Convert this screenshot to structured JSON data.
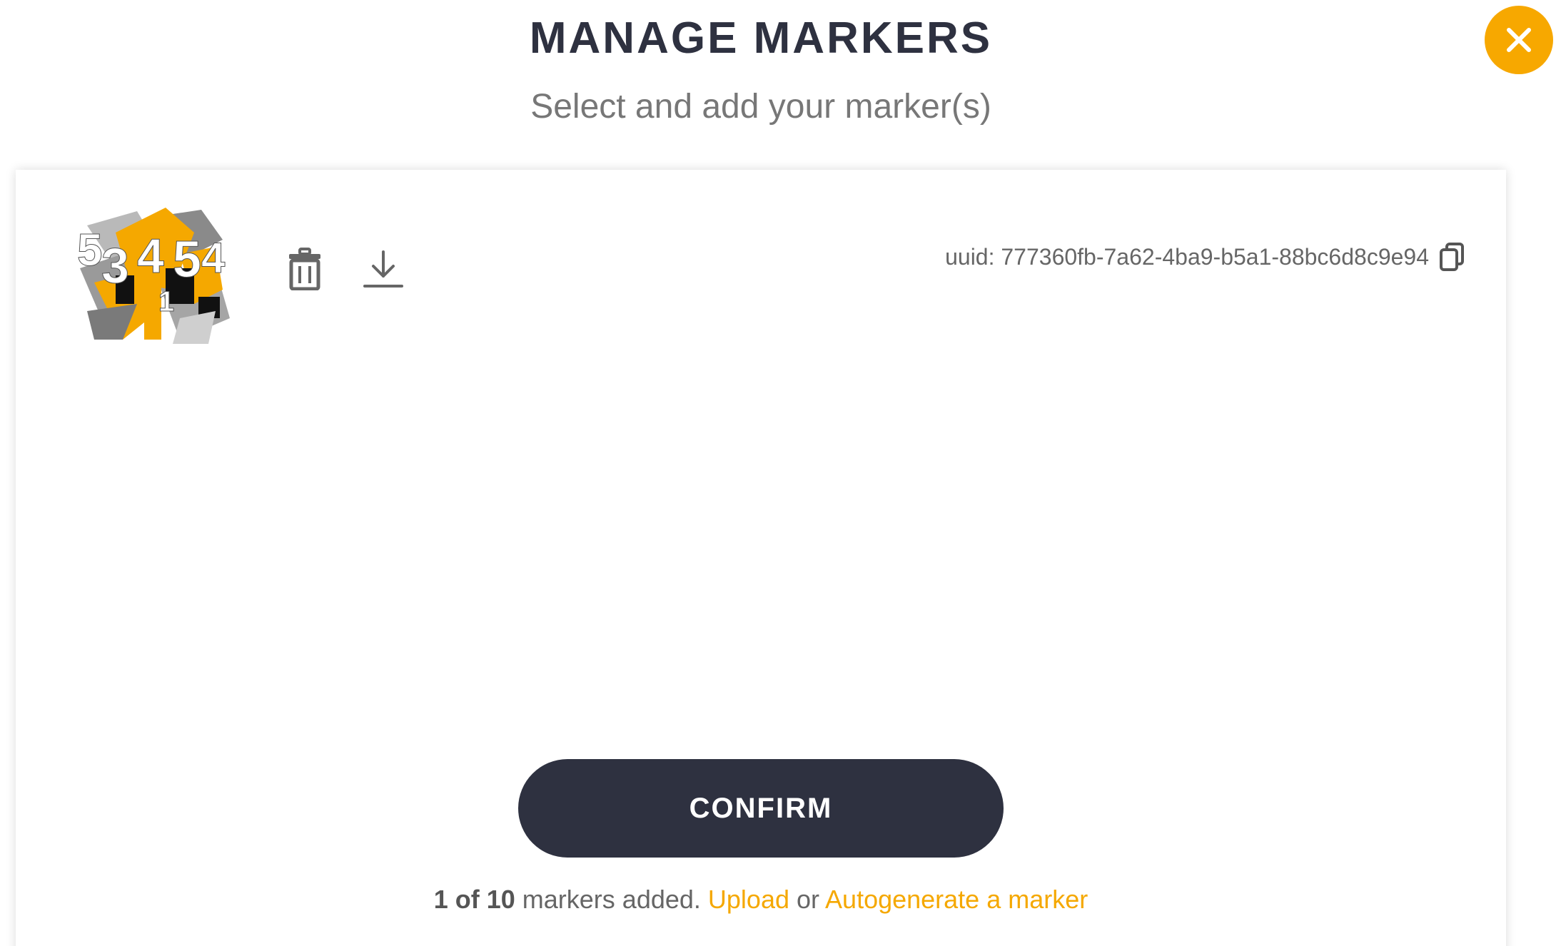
{
  "header": {
    "title": "MANAGE MARKERS",
    "subtitle": "Select and add your marker(s)"
  },
  "close_icon": "close-icon",
  "markers": [
    {
      "uuid_label": "uuid: 777360fb-7a62-4ba9-b5a1-88bc6d8c9e94",
      "actions": {
        "delete_icon": "trash-icon",
        "download_icon": "download-icon",
        "copy_icon": "copy-icon"
      }
    }
  ],
  "confirm": {
    "label": "CONFIRM"
  },
  "footer": {
    "count_strong": "1 of 10",
    "count_rest": " markers added. ",
    "upload_label": "Upload",
    "or_label": " or ",
    "autogenerate_label": "Autogenerate a marker"
  },
  "colors": {
    "accent": "#f7a800",
    "dark": "#2e3140",
    "muted_text": "#777777"
  }
}
